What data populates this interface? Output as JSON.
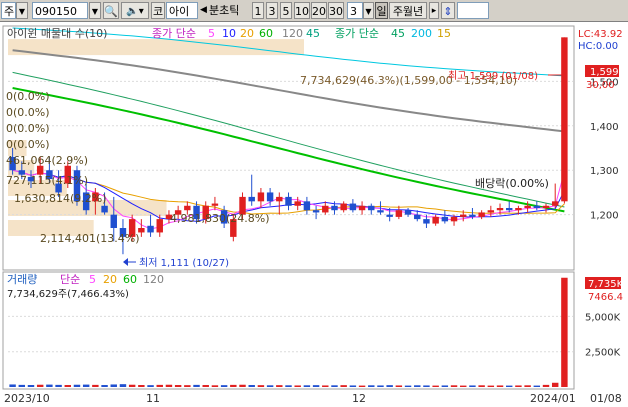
{
  "toolbar": {
    "market_selector": "주",
    "stock_code": "090150",
    "search_icon": "search-icon",
    "sound_icon": "speaker-icon",
    "market_tag": "코",
    "stock_name": "아이",
    "period_prev_icon": "triangle-left-icon",
    "period_label": "분초틱",
    "intervals": [
      "1",
      "3",
      "5",
      "10",
      "20",
      "30"
    ],
    "interval_value": "3",
    "day_button": "일",
    "week_month_year": "주월년",
    "collapse_icon": "chevron-right-icon",
    "scroll_icon": "up-down-arrow-icon"
  },
  "price_panel": {
    "legend_title": "아이윈 매물대 수(10)",
    "ma_label_1": "종가 단순",
    "ma_periods_1": [
      "5",
      "10",
      "20",
      "60",
      "120",
      "45"
    ],
    "ma_label_2": "종가 단순",
    "ma_periods_2": [
      "45",
      "200",
      "15"
    ],
    "lc_label": "LC:43.92",
    "hc_label": "HC:0.00",
    "current_price_badge": "1,599",
    "sub_badge": "30,00",
    "high_annotation": "최고 1,599 (01/08)",
    "low_annotation": "최저 1,111 (10/27)",
    "dividend_annotation": "배당락(0.00%)",
    "volume_profile_labels": [
      "7,734,629(46.3%)(1,599,00 - 1,554,10)",
      "0(0.0%)",
      "0(0.0%)",
      "0(0.0%)",
      "0(0.0%)",
      "461,064(2.9%)",
      "727,115(4.1%)",
      "1,630,814(9.2%)",
      "4,981,830(24.8%)",
      "2,114,401(13.4%)"
    ]
  },
  "volume_panel": {
    "legend_title": "거래량",
    "ma_label": "단순",
    "ma_periods": [
      "5",
      "20",
      "60",
      "120"
    ],
    "current_volume_text": "7,734,629주(7,466.43%)",
    "current_badge": "7,735K",
    "sub_badge": "7466.4"
  },
  "x_axis_labels": [
    "2023/10",
    "11",
    "12",
    "2024/01",
    "01/08"
  ],
  "colors": {
    "up": "#e02020",
    "down": "#2050d0",
    "ma5": "#ff44ff",
    "ma10": "#2020ff",
    "ma20": "#e8a000",
    "ma60": "#00c000",
    "ma120": "#888888",
    "ma200": "#00c8e0",
    "profile": "#f5e3c8"
  },
  "chart_data": {
    "type": "candlestick",
    "price_axis": {
      "ticks": [
        1200,
        1300,
        1400,
        1500
      ],
      "ylim": [
        1080,
        1620
      ]
    },
    "volume_axis": {
      "ticks": [
        2500,
        5000
      ],
      "unit": "K",
      "ylim": [
        0,
        8000
      ]
    },
    "candles": [
      [
        1,
        1330,
        1350,
        1290,
        1300
      ],
      [
        2,
        1300,
        1320,
        1280,
        1290
      ],
      [
        3,
        1285,
        1300,
        1260,
        1275
      ],
      [
        4,
        1290,
        1330,
        1270,
        1310
      ],
      [
        5,
        1300,
        1330,
        1270,
        1280
      ],
      [
        6,
        1270,
        1300,
        1240,
        1250
      ],
      [
        7,
        1270,
        1320,
        1260,
        1310
      ],
      [
        8,
        1300,
        1310,
        1220,
        1230
      ],
      [
        9,
        1250,
        1270,
        1200,
        1210
      ],
      [
        10,
        1230,
        1260,
        1200,
        1250
      ],
      [
        11,
        1220,
        1250,
        1200,
        1205
      ],
      [
        12,
        1200,
        1240,
        1140,
        1170
      ],
      [
        13,
        1170,
        1190,
        1111,
        1150
      ],
      [
        14,
        1150,
        1200,
        1140,
        1190
      ],
      [
        15,
        1160,
        1190,
        1150,
        1170
      ],
      [
        16,
        1175,
        1200,
        1150,
        1160
      ],
      [
        17,
        1160,
        1200,
        1150,
        1190
      ],
      [
        18,
        1190,
        1210,
        1180,
        1200
      ],
      [
        19,
        1200,
        1220,
        1190,
        1210
      ],
      [
        20,
        1210,
        1230,
        1200,
        1220
      ],
      [
        21,
        1220,
        1230,
        1180,
        1190
      ],
      [
        22,
        1190,
        1230,
        1180,
        1220
      ],
      [
        23,
        1220,
        1240,
        1210,
        1225
      ],
      [
        24,
        1210,
        1220,
        1170,
        1180
      ],
      [
        25,
        1150,
        1200,
        1140,
        1190
      ],
      [
        26,
        1200,
        1250,
        1190,
        1240
      ],
      [
        27,
        1240,
        1290,
        1220,
        1230
      ],
      [
        28,
        1230,
        1260,
        1215,
        1250
      ],
      [
        29,
        1250,
        1260,
        1220,
        1230
      ],
      [
        30,
        1230,
        1250,
        1200,
        1240
      ],
      [
        31,
        1240,
        1250,
        1210,
        1220
      ],
      [
        32,
        1220,
        1240,
        1210,
        1230
      ],
      [
        33,
        1230,
        1240,
        1200,
        1210
      ],
      [
        34,
        1210,
        1220,
        1190,
        1205
      ],
      [
        35,
        1205,
        1230,
        1200,
        1220
      ],
      [
        36,
        1220,
        1230,
        1200,
        1210
      ],
      [
        37,
        1210,
        1230,
        1205,
        1225
      ],
      [
        38,
        1225,
        1235,
        1205,
        1210
      ],
      [
        39,
        1210,
        1230,
        1200,
        1220
      ],
      [
        40,
        1220,
        1225,
        1200,
        1210
      ],
      [
        41,
        1210,
        1230,
        1200,
        1205
      ],
      [
        42,
        1200,
        1215,
        1185,
        1195
      ],
      [
        43,
        1195,
        1220,
        1190,
        1210
      ],
      [
        44,
        1210,
        1215,
        1195,
        1200
      ],
      [
        45,
        1200,
        1210,
        1185,
        1190
      ],
      [
        46,
        1190,
        1200,
        1170,
        1180
      ],
      [
        47,
        1180,
        1200,
        1175,
        1195
      ],
      [
        48,
        1195,
        1210,
        1180,
        1185
      ],
      [
        49,
        1185,
        1200,
        1175,
        1195
      ],
      [
        50,
        1195,
        1210,
        1185,
        1200
      ],
      [
        51,
        1200,
        1215,
        1190,
        1195
      ],
      [
        52,
        1195,
        1210,
        1190,
        1205
      ],
      [
        53,
        1205,
        1220,
        1195,
        1210
      ],
      [
        54,
        1210,
        1225,
        1200,
        1215
      ],
      [
        55,
        1215,
        1230,
        1205,
        1210
      ],
      [
        56,
        1210,
        1220,
        1200,
        1215
      ],
      [
        57,
        1215,
        1230,
        1205,
        1220
      ],
      [
        58,
        1220,
        1230,
        1210,
        1215
      ],
      [
        59,
        1215,
        1225,
        1205,
        1220
      ],
      [
        60,
        1220,
        1270,
        1215,
        1230
      ],
      [
        61,
        1230,
        1599,
        1225,
        1599
      ]
    ],
    "volume_k": [
      180,
      150,
      140,
      160,
      170,
      150,
      140,
      160,
      170,
      150,
      140,
      180,
      200,
      160,
      140,
      130,
      150,
      160,
      140,
      130,
      150,
      140,
      120,
      130,
      150,
      160,
      140,
      130,
      120,
      130,
      120,
      110,
      120,
      130,
      110,
      120,
      130,
      110,
      100,
      120,
      110,
      130,
      110,
      100,
      120,
      110,
      100,
      110,
      120,
      100,
      110,
      120,
      100,
      110,
      100,
      110,
      120,
      100,
      150,
      300,
      7735
    ],
    "volume_profile_pct": [
      46.3,
      0,
      0,
      0,
      0,
      2.9,
      4.1,
      9.2,
      24.8,
      13.4
    ]
  }
}
